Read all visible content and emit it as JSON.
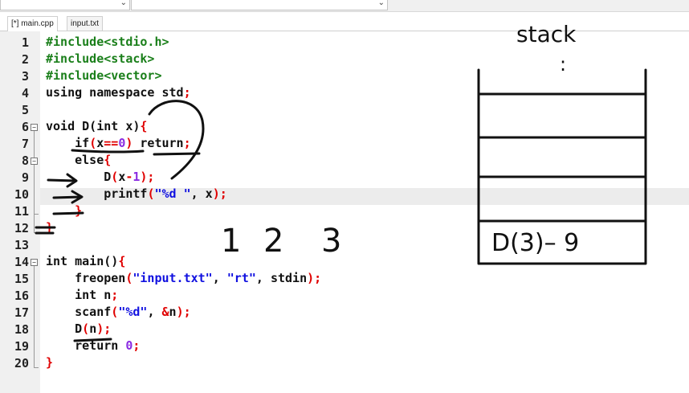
{
  "tabs": [
    {
      "label": "[*] main.cpp",
      "active": true
    },
    {
      "label": "input.txt",
      "active": false
    }
  ],
  "line_numbers": [
    "1",
    "2",
    "3",
    "4",
    "5",
    "6",
    "7",
    "8",
    "9",
    "10",
    "11",
    "12",
    "13",
    "14",
    "15",
    "16",
    "17",
    "18",
    "19",
    "20"
  ],
  "code": {
    "l1": "#include<stdio.h>",
    "l2": "#include<stack>",
    "l3": "#include<vector>",
    "l4a": "using namespace std",
    "l4b": ";",
    "l6a": "void D(int x)",
    "l6b": "{",
    "l7a": "    if",
    "l7b": "(",
    "l7c": "x",
    "l7d": "==",
    "l7e": "0",
    "l7f": ")",
    "l7g": " return",
    "l7h": ";",
    "l8a": "    else",
    "l8b": "{",
    "l9a": "        D",
    "l9b": "(",
    "l9c": "x",
    "l9d": "-",
    "l9e": "1",
    "l9f": ");",
    "l10a": "        printf",
    "l10b": "(",
    "l10c": "\"%d \"",
    "l10d": ", x",
    "l10e": ");",
    "l11": "    }",
    "l12": "}",
    "l14a": "int main()",
    "l14b": "{",
    "l15a": "    freopen",
    "l15b": "(",
    "l15c": "\"input.txt\"",
    "l15d": ", ",
    "l15e": "\"rt\"",
    "l15f": ", stdin",
    "l15g": ");",
    "l16a": "    int n",
    "l16b": ";",
    "l17a": "    scanf",
    "l17b": "(",
    "l17c": "\"%d\"",
    "l17d": ", ",
    "l17e": "&",
    "l17f": "n",
    "l17g": ");",
    "l18a": "    D",
    "l18b": "(",
    "l18c": "n",
    "l18d": ");",
    "l19a": "    return ",
    "l19b": "0",
    "l19c": ";",
    "l20": "}"
  },
  "annotations": {
    "stack_label": "stack",
    "stack_dots": ":",
    "stack_bottom_entry": "D(3)– 9",
    "sequence": [
      "1",
      "2",
      "3"
    ]
  },
  "colors": {
    "preprocessor": "#1a7f1a",
    "string": "#1010e0",
    "operator": "#e00000",
    "number": "#8a2be2",
    "ink": "#111111",
    "current_line": "#ececec"
  }
}
